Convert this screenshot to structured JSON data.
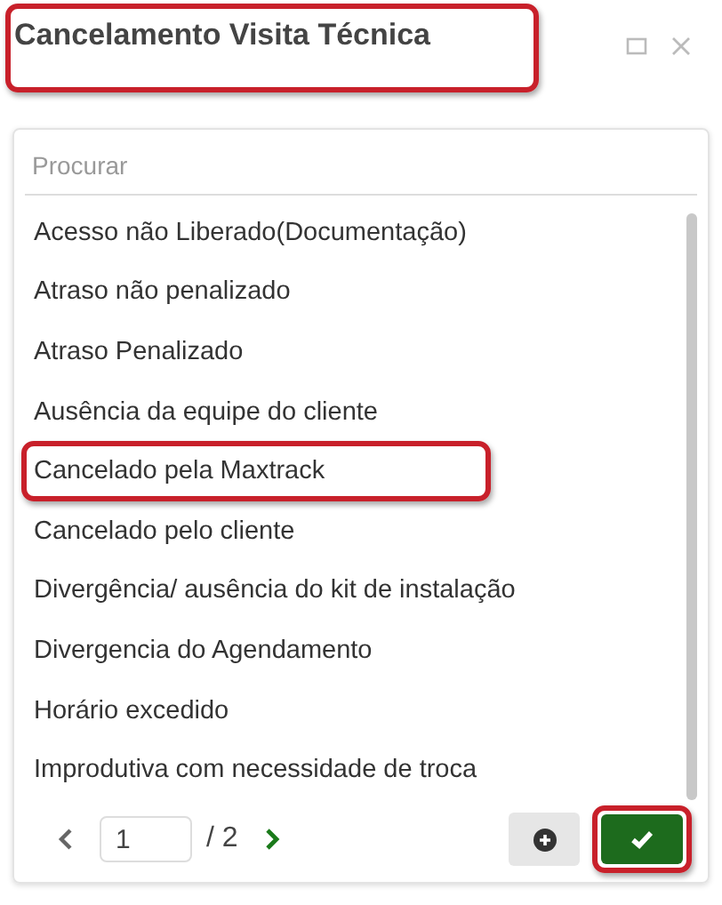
{
  "window": {
    "title": "Cancelamento Visita Técnica",
    "title_highlighted": true
  },
  "search": {
    "placeholder": "Procurar"
  },
  "items": [
    {
      "label": "Acesso não Liberado(Documentação)",
      "highlighted": false
    },
    {
      "label": "Atraso não penalizado",
      "highlighted": false
    },
    {
      "label": "Atraso Penalizado",
      "highlighted": false
    },
    {
      "label": "Ausência da equipe do cliente",
      "highlighted": false
    },
    {
      "label": "Cancelado pela Maxtrack",
      "highlighted": true
    },
    {
      "label": "Cancelado pelo cliente",
      "highlighted": false
    },
    {
      "label": "Divergência/ ausência do kit de instalação",
      "highlighted": false
    },
    {
      "label": "Divergencia do Agendamento",
      "highlighted": false
    },
    {
      "label": "Horário excedido",
      "highlighted": false
    },
    {
      "label": "Improdutiva com necessidade de troca",
      "highlighted": false
    }
  ],
  "pager": {
    "page": "1",
    "total": "/ 2"
  },
  "confirm_highlighted": true
}
